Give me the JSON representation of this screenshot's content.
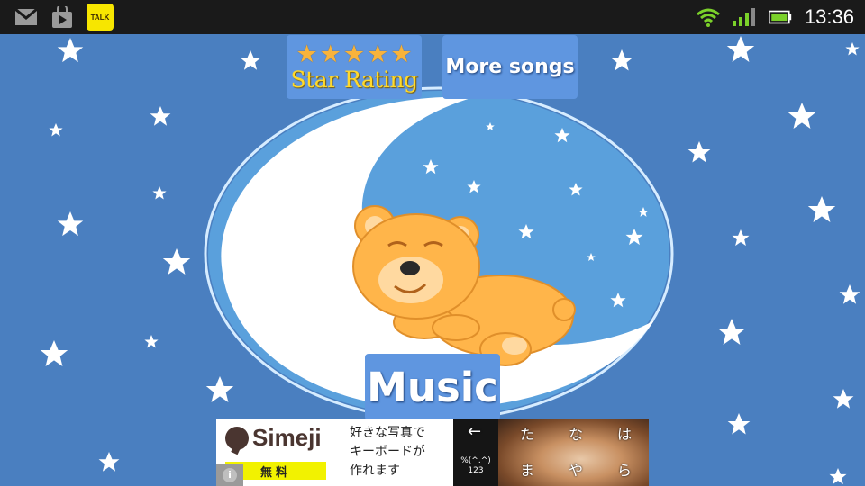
{
  "status_bar": {
    "left_icons": [
      "gmail-icon",
      "play-store-icon",
      "kakaotalk-icon"
    ],
    "talk_label": "TALK",
    "right_icons": [
      "wifi-icon",
      "signal-icon",
      "battery-icon"
    ],
    "time": "13:36"
  },
  "buttons": {
    "rating_label": "Star Rating",
    "rating_stars": 5,
    "more_songs": "More songs",
    "music": "Music"
  },
  "ad": {
    "brand": "Simeji",
    "free_label": "無料",
    "copy_line1": "好きな写真で",
    "copy_line2": "キーボードが",
    "copy_line3": "作れます",
    "info_label": "i",
    "kbd_arrow": "←",
    "kbd_symbol": "%(^.^)",
    "kbd_numbers": "123",
    "kbd_keys": [
      "た",
      "な",
      "は",
      "ま",
      "や",
      "ら"
    ]
  },
  "colors": {
    "background": "#4a7fc0",
    "button": "#5f96e0",
    "star_rating_text": "#ffd92b",
    "rating_star": "#f8b33b",
    "moon_circle": "#5aa0dc"
  }
}
